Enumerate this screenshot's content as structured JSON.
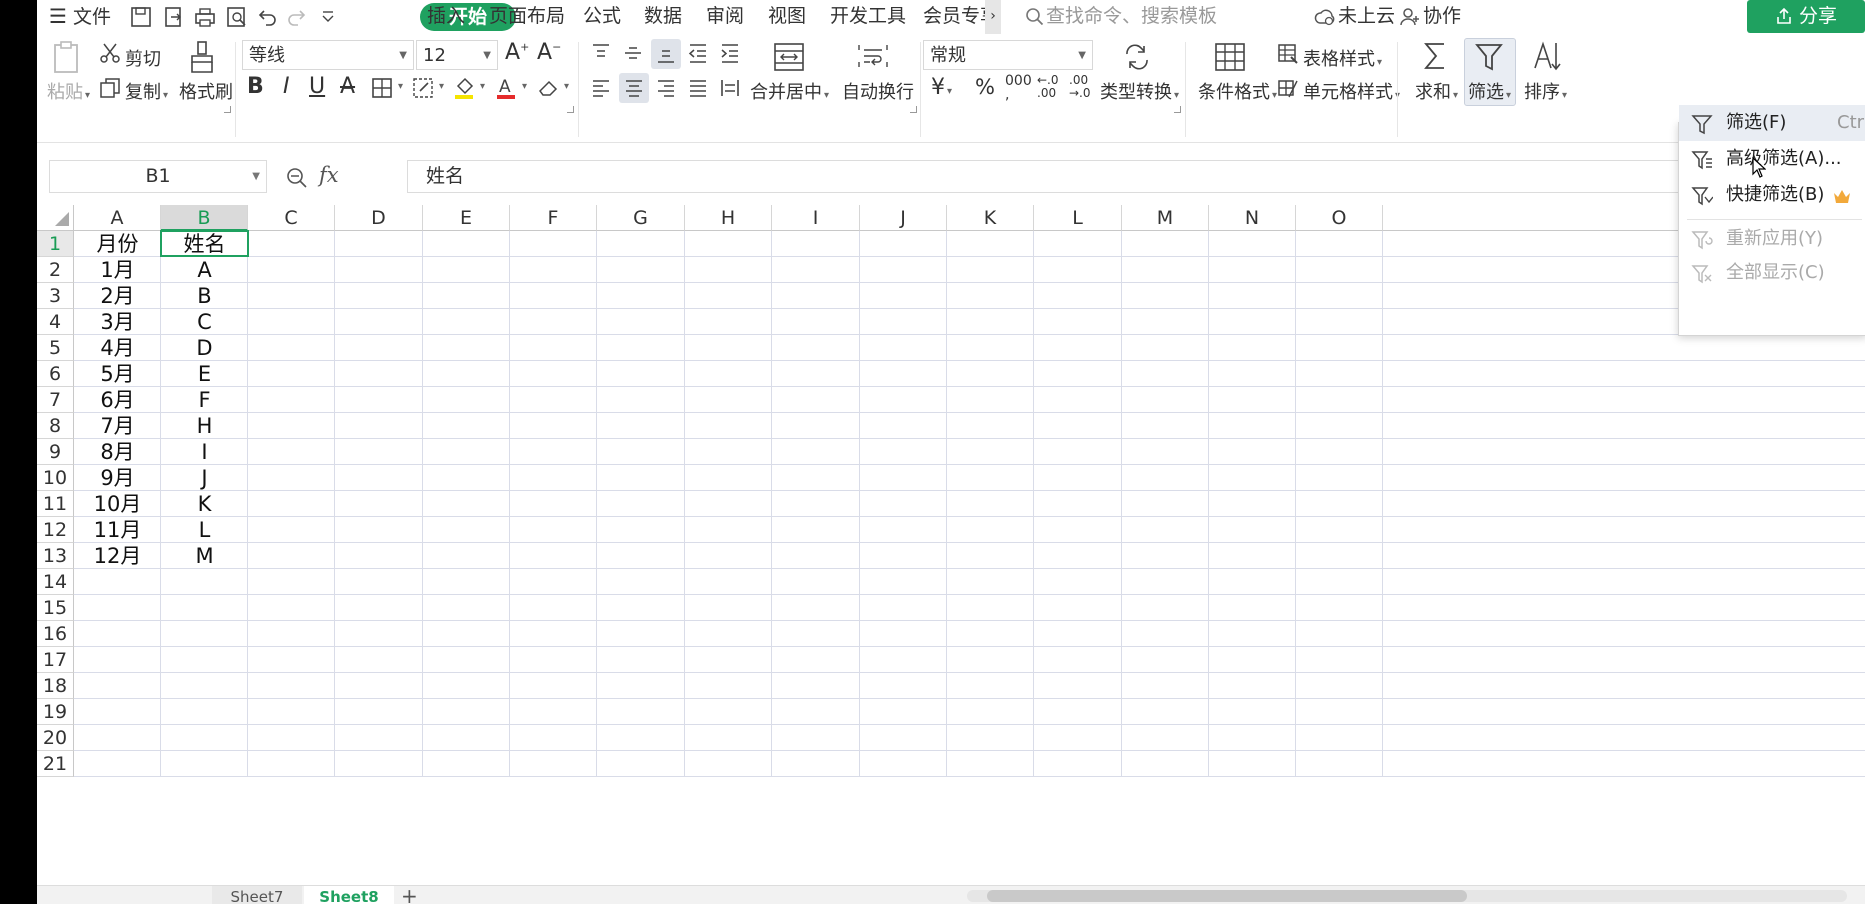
{
  "menubar": {
    "file": "文件",
    "tabs": [
      "开始",
      "插入",
      "页面布局",
      "公式",
      "数据",
      "审阅",
      "视图",
      "开发工具",
      "会员专享"
    ],
    "search_placeholder": "查找命令、搜索模板",
    "cloud": "未上云",
    "collab": "协作",
    "share": "分享"
  },
  "ribbon": {
    "paste": "粘贴",
    "cut": "剪切",
    "copy": "复制",
    "format_painter": "格式刷",
    "font_name": "等线",
    "font_size": "12",
    "merge_center": "合并居中",
    "wrap_text": "自动换行",
    "number_format": "常规",
    "type_convert": "类型转换",
    "cond_format": "条件格式",
    "table_style": "表格样式",
    "cell_style": "单元格样式",
    "sum": "求和",
    "filter": "筛选",
    "sort": "排序",
    "currency": "¥",
    "percent": "%",
    "thousands": "000"
  },
  "formula_bar": {
    "cell_ref": "B1",
    "fx": "fx",
    "content": "姓名"
  },
  "columns": [
    "A",
    "B",
    "C",
    "D",
    "E",
    "F",
    "G",
    "H",
    "I",
    "J",
    "K",
    "L",
    "M",
    "N",
    "O"
  ],
  "rows": [
    "1",
    "2",
    "3",
    "4",
    "5",
    "6",
    "7",
    "8",
    "9",
    "10",
    "11",
    "12",
    "13",
    "14",
    "15",
    "16",
    "17",
    "18",
    "19",
    "20",
    "21"
  ],
  "table": [
    [
      "月份",
      "姓名"
    ],
    [
      "1月",
      "A"
    ],
    [
      "2月",
      "B"
    ],
    [
      "3月",
      "C"
    ],
    [
      "4月",
      "D"
    ],
    [
      "5月",
      "E"
    ],
    [
      "6月",
      "F"
    ],
    [
      "7月",
      "H"
    ],
    [
      "8月",
      "I"
    ],
    [
      "9月",
      "J"
    ],
    [
      "10月",
      "K"
    ],
    [
      "11月",
      "L"
    ],
    [
      "12月",
      "M"
    ]
  ],
  "sheets": [
    "Sheet7",
    "Sheet8"
  ],
  "filter_menu": {
    "items": [
      {
        "label": "筛选(F)",
        "shortcut": "Ctrl"
      },
      {
        "label": "高级筛选(A)..."
      },
      {
        "label": "快捷筛选(B)"
      },
      {
        "label": "重新应用(Y)"
      },
      {
        "label": "全部显示(C)"
      }
    ]
  },
  "colors": {
    "accent": "#1fa160",
    "selection_header": "#dadada",
    "gridline": "#d9dce8"
  }
}
